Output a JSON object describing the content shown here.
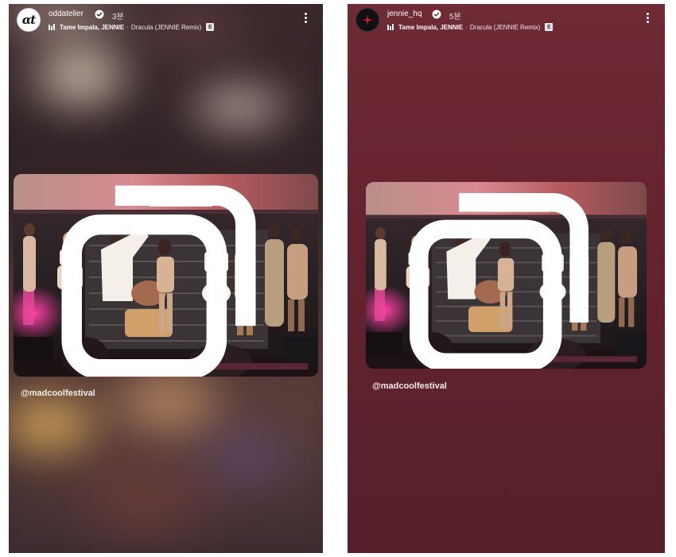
{
  "stories": [
    {
      "username": "oddatelier",
      "avatar_text": "αt",
      "time_ago": "3분",
      "music": {
        "artist": "Tame Impala, JENNIE",
        "separator": "·",
        "title": "Dracula (JENNIE Remix)",
        "explicit": "E"
      },
      "mention": "@madcoolfestival",
      "icons": [
        "verified-badge-icon",
        "music-bars-icon",
        "more-options-icon",
        "carousel-icon"
      ],
      "background": "blurred-photo"
    },
    {
      "username": "jennie_hq",
      "time_ago": "5분",
      "music": {
        "artist": "Tame Impala, JENNIE",
        "separator": "·",
        "title": "Dracula (JENNIE Remix)",
        "explicit": "E"
      },
      "mention": "@madcoolfestival",
      "icons": [
        "verified-badge-icon",
        "music-bars-icon",
        "more-options-icon",
        "carousel-icon"
      ],
      "background": "#6a2632"
    }
  ]
}
